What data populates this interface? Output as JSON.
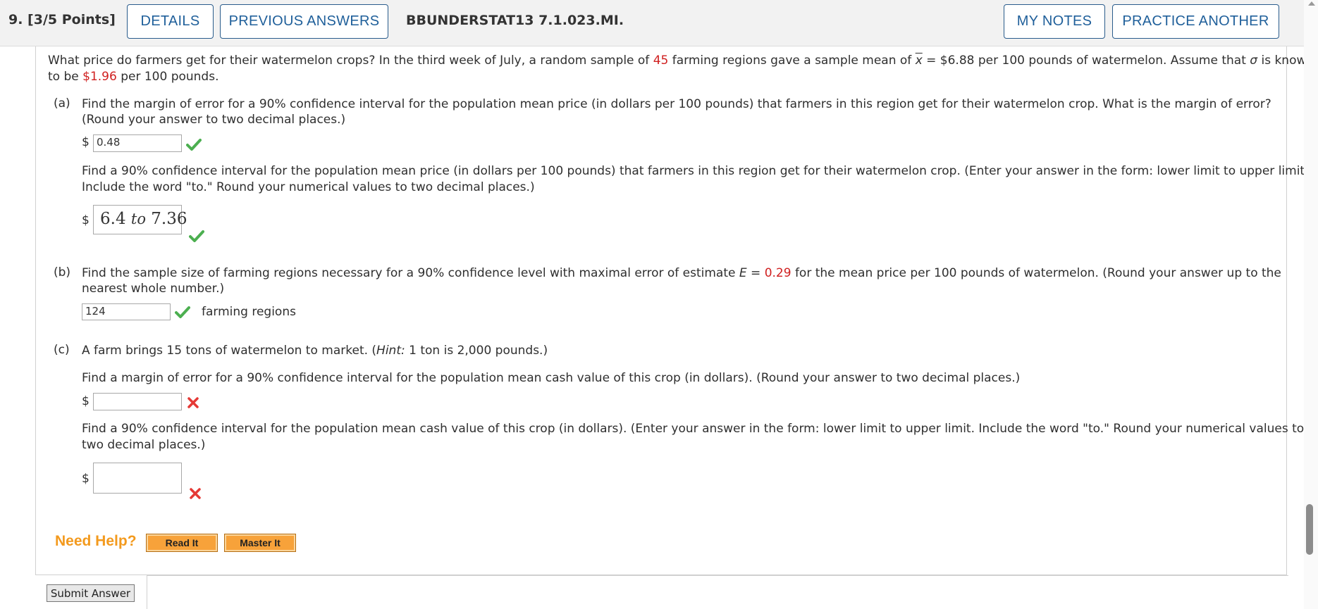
{
  "header": {
    "question_number": "9.  [3/5 Points]",
    "details_label": "DETAILS",
    "previous_answers_label": "PREVIOUS ANSWERS",
    "question_code": "BBUNDERSTAT13 7.1.023.MI.",
    "my_notes_label": "MY NOTES",
    "practice_another_label": "PRACTICE ANOTHER"
  },
  "intro": {
    "line1_a": "What price do farmers get for their watermelon crops? In the third week of July, a random sample of ",
    "n_value": "45",
    "line1_b": " farming regions gave a sample mean of ",
    "xbar_symbol": "x",
    "line1_c": " = $6.88 per 100 pounds of watermelon. Assume that ",
    "sigma_symbol": "σ",
    "line1_d": " is known",
    "line2_a": "to be ",
    "sigma_value": "$1.96",
    "line2_b": " per 100 pounds."
  },
  "part_a": {
    "label": "(a)",
    "q1_line1": "Find the margin of error for a 90% confidence interval for the population mean price (in dollars per 100 pounds) that farmers in this region get for their watermelon crop. What is the margin of error?",
    "q1_line2": "(Round your answer to two decimal places.)",
    "currency": "$",
    "answer1": "0.48",
    "q2_line1": "Find a 90% confidence interval for the population mean price (in dollars per 100 pounds) that farmers in this region get for their watermelon crop. (Enter your answer in the form: lower limit to upper limit.",
    "q2_line2": "Include the word \"to.\" Round your numerical values to two decimal places.)",
    "answer2_low": "6.4",
    "answer2_to": "to",
    "answer2_high": "7.36"
  },
  "part_b": {
    "label": "(b)",
    "line1_a": "Find the sample size of farming regions necessary for a 90% confidence level with maximal error of estimate ",
    "e_symbol": "E",
    "line1_b": " = ",
    "e_value": "0.29",
    "line1_c": " for the mean price per 100 pounds of watermelon. (Round your answer up to the",
    "line2": "nearest whole number.)",
    "answer": "124",
    "unit": "farming regions"
  },
  "part_c": {
    "label": "(c)",
    "intro_a": "A farm brings 15 tons of watermelon to market. (",
    "hint_word": "Hint:",
    "intro_b": " 1 ton is 2,000 pounds.)",
    "q1": "Find a margin of error for a 90% confidence interval for the population mean cash value of this crop (in dollars). (Round your answer to two decimal places.)",
    "currency": "$",
    "answer1": "",
    "q2_line1": "Find a 90% confidence interval for the population mean cash value of this crop (in dollars). (Enter your answer in the form: lower limit to upper limit. Include the word \"to.\" Round your numerical values to",
    "q2_line2": "two decimal places.)",
    "answer2": ""
  },
  "help": {
    "need_help_label": "Need Help?",
    "read_it_label": "Read It",
    "master_it_label": "Master It"
  },
  "footer": {
    "submit_label": "Submit Answer"
  },
  "colors": {
    "accent_blue": "#1f5f9a",
    "highlight_red": "#d02020",
    "correct_green": "#4caf50",
    "incorrect_red": "#e53935",
    "help_orange": "#f39a1e"
  }
}
